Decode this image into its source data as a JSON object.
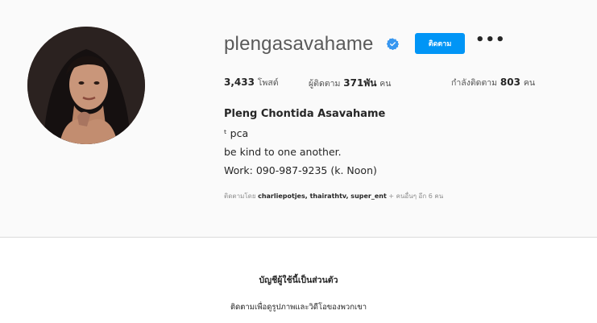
{
  "profile": {
    "username": "plengasavahame",
    "verified": true,
    "follow_label": "ติดตาม",
    "more_label": "•••",
    "stats": {
      "posts_count": "3,433",
      "posts_label": "โพสต์",
      "followers_label": "ผู้ติดตาม",
      "followers_count": "371พัน",
      "followers_unit": "คน",
      "following_label": "กำลังติดตาม",
      "following_count": "803",
      "following_unit": "คน"
    },
    "full_name": "Pleng Chontida Asavahame",
    "bio_lines": [
      "ᵗ pca",
      "be kind to one another.",
      "Work: 090-987-9235 (k. Noon)"
    ],
    "followed_by": {
      "prefix": "ติดตามโดย",
      "accounts": "charliepotjes, thairathtv, super_ent",
      "suffix": "+ คนอื่นๆ อีก 6 คน"
    }
  },
  "private_notice": {
    "title": "บัญชีผู้ใช้นี้เป็นส่วนตัว",
    "subtitle": "ติดตามเพื่อดูรูปภาพและวิดีโอของพวกเขา"
  },
  "colors": {
    "accent": "#0095f6",
    "verified": "#3897f0",
    "background": "#fafafa"
  }
}
